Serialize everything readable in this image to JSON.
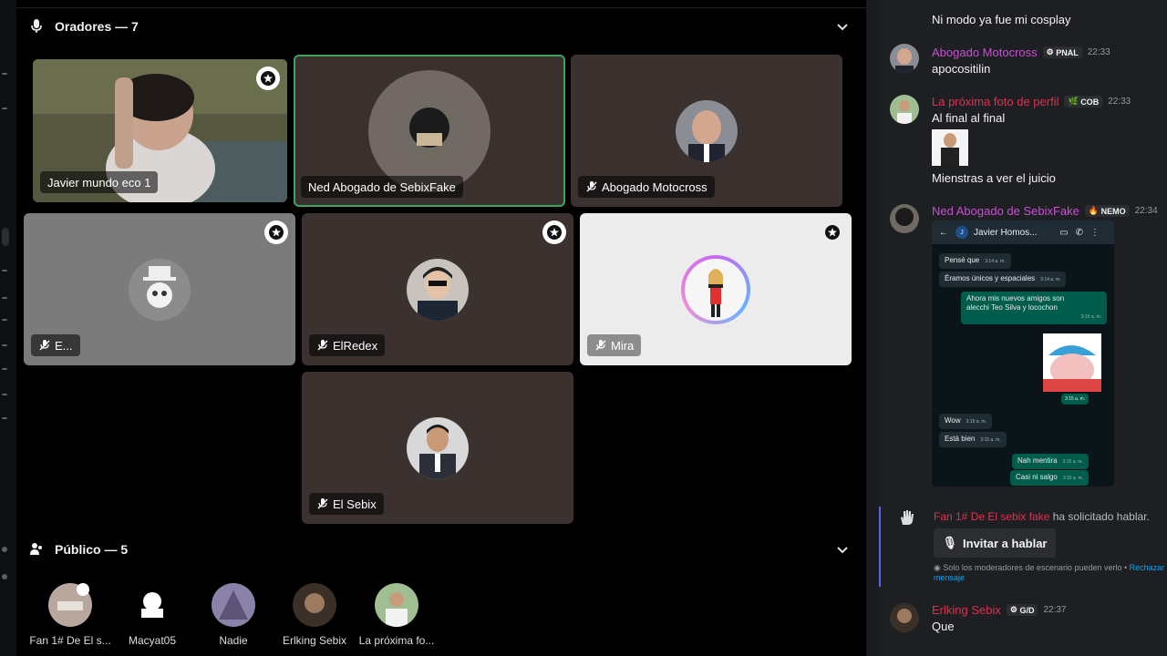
{
  "stage": {
    "speakers_header": "Oradores — 7",
    "tiles": [
      {
        "name": "Javier mundo eco 1",
        "muted": false,
        "moderator": true,
        "speaking": true
      },
      {
        "name": "Ned Abogado de SebixFake",
        "muted": false,
        "moderator": false,
        "speaking": true
      },
      {
        "name": "Abogado Motocross",
        "muted": true,
        "moderator": false,
        "speaking": false
      },
      {
        "name": "E...",
        "muted": true,
        "moderator": true,
        "speaking": false
      },
      {
        "name": "ElRedex",
        "muted": true,
        "moderator": true,
        "speaking": false
      },
      {
        "name": "Mira",
        "muted": true,
        "moderator": true,
        "speaking": false
      },
      {
        "name": "El Sebix",
        "muted": true,
        "moderator": false,
        "speaking": false
      }
    ],
    "audience_header": "Público — 5",
    "audience": [
      {
        "name": "Fan 1# De El s..."
      },
      {
        "name": "Macyat05"
      },
      {
        "name": "Nadie"
      },
      {
        "name": "Erlking Sebix"
      },
      {
        "name": "La próxima fo..."
      }
    ]
  },
  "chat": {
    "messages": [
      {
        "text": "Ni modo ya fue mi cosplay"
      },
      {
        "user": "Abogado Motocross",
        "color": "#c94fd6",
        "tag": "PNAL",
        "time": "22:33",
        "text": "apocositilin"
      },
      {
        "user": "La próxima foto de perfil",
        "color": "#e0304f",
        "tag": "COB",
        "time": "22:33",
        "text": "Al final al final",
        "text2": "Mienstras a ver el juicio"
      },
      {
        "user": "Ned Abogado de SebixFake",
        "color": "#c94fd6",
        "tag": "NEMO",
        "time": "22:34"
      }
    ],
    "whatsapp": {
      "contact": "Javier Homos...",
      "bubbles": [
        {
          "text": "Pensé que",
          "time": "3:14 a. m."
        },
        {
          "text": "Éramos únicos y espaciales",
          "time": "3:14 a. m."
        },
        {
          "text": "Ahora mis nuevos amigos son",
          "text2": "alecchi Teo Silva y locochon",
          "time": "3:15 a. m."
        },
        {
          "text": "Wow",
          "time": "3:15 a. m."
        },
        {
          "text": "Está bien",
          "time": "3:15 a. m."
        },
        {
          "text": "Nah mentira",
          "time": "3:15 a. m."
        },
        {
          "text": "Casi ni salgo",
          "time": "3:15 a. m."
        }
      ],
      "sticker_time": "3:15 a. m."
    },
    "request": {
      "user": "Fan 1# De El sebix fake",
      "action": "ha solicitado hablar.",
      "button": "Invitar a hablar",
      "note": "Solo los moderadores de escenario pueden verlo • ",
      "note_link": "Rechazar mensaje"
    },
    "last": {
      "user": "Erlking Sebix",
      "color": "#e0304f",
      "tag": "G/D",
      "time": "22:37",
      "text": "Que"
    }
  }
}
